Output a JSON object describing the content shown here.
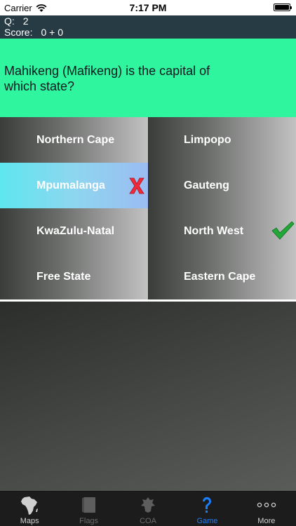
{
  "status_bar": {
    "carrier": "Carrier",
    "time": "7:17 PM"
  },
  "info": {
    "q_label": "Q:",
    "q_value": "2",
    "score_label": "Score:",
    "score_value": "0 + 0"
  },
  "question": {
    "text": "Mahikeng (Mafikeng) is the capital of which state?"
  },
  "answers": [
    {
      "label": "Northern Cape",
      "state": "normal"
    },
    {
      "label": "Limpopo",
      "state": "normal"
    },
    {
      "label": "Mpumalanga",
      "state": "wrong"
    },
    {
      "label": "Gauteng",
      "state": "normal"
    },
    {
      "label": "KwaZulu-Natal",
      "state": "normal"
    },
    {
      "label": "North West",
      "state": "correct"
    },
    {
      "label": "Free State",
      "state": "normal"
    },
    {
      "label": "Eastern Cape",
      "state": "normal"
    }
  ],
  "tabs": [
    {
      "label": "Maps",
      "icon": "africa-map-icon",
      "state": "normal"
    },
    {
      "label": "Flags",
      "icon": "flag-book-icon",
      "state": "dim"
    },
    {
      "label": "COA",
      "icon": "coat-of-arms-icon",
      "state": "dim"
    },
    {
      "label": "Game",
      "icon": "question-mark-icon",
      "state": "active"
    },
    {
      "label": "More",
      "icon": "more-dots-icon",
      "state": "normal"
    }
  ],
  "colors": {
    "info_bg": "#263b44",
    "question_bg": "#2ef59e",
    "active_tab": "#1a7fff",
    "wrong_mark": "#ef2b3b",
    "correct_mark": "#22a838"
  }
}
